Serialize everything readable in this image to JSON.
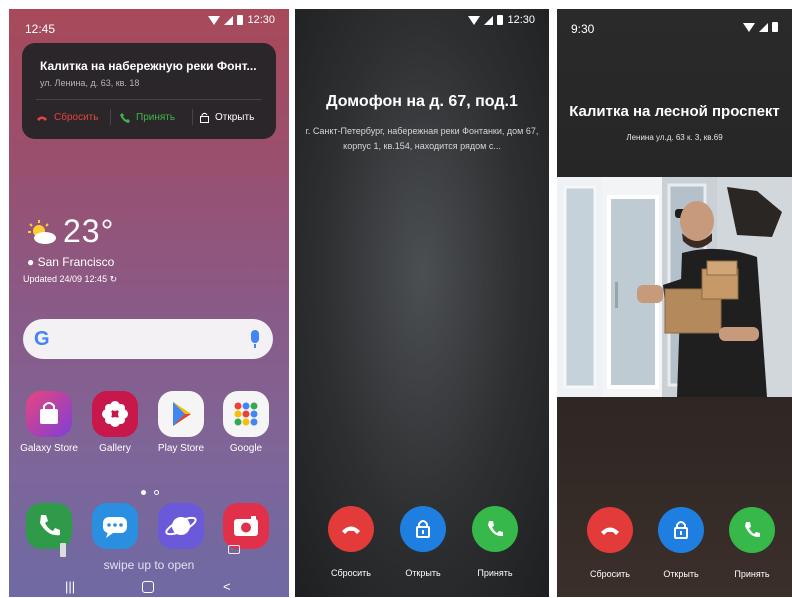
{
  "phone1": {
    "status": {
      "time_left": "12:45",
      "time_right": "12:30"
    },
    "notification": {
      "title": "Калитка на набережную реки Фонт...",
      "subtitle": "ул. Ленина, д. 63, кв. 18",
      "reset_label": "Сбросить",
      "accept_label": "Принять",
      "open_label": "Открыть"
    },
    "weather": {
      "temp": "23°",
      "location": "San Francisco",
      "updated": "Updated 24/09 12:45"
    },
    "apps_row1": [
      {
        "label": "Galaxy Store",
        "color": "#8e3fd3"
      },
      {
        "label": "Gallery",
        "color": "#c8174b"
      },
      {
        "label": "Play Store",
        "color": "#f5f5f5"
      },
      {
        "label": "Google",
        "color": "#f5f5f5"
      }
    ],
    "swipe_hint": "swipe up to open"
  },
  "phone2": {
    "status": {
      "time": "12:30"
    },
    "title": "Домофон на д. 67, под.1",
    "address": "г. Санкт-Петербург, набережная реки Фонтанки, дом 67, корпус 1, кв.154, находится рядом с...",
    "reset_label": "Сбросить",
    "open_label": "Открыть",
    "accept_label": "Принять"
  },
  "phone3": {
    "status": {
      "time": "9:30"
    },
    "title": "Калитка на лесной проспект",
    "address": "Ленина ул.д. 63 к. 3, кв.69",
    "reset_label": "Сбросить",
    "open_label": "Открыть",
    "accept_label": "Принять"
  },
  "colors": {
    "decline": "#e33a3a",
    "open": "#1f7fe0",
    "accept": "#37b84a"
  }
}
